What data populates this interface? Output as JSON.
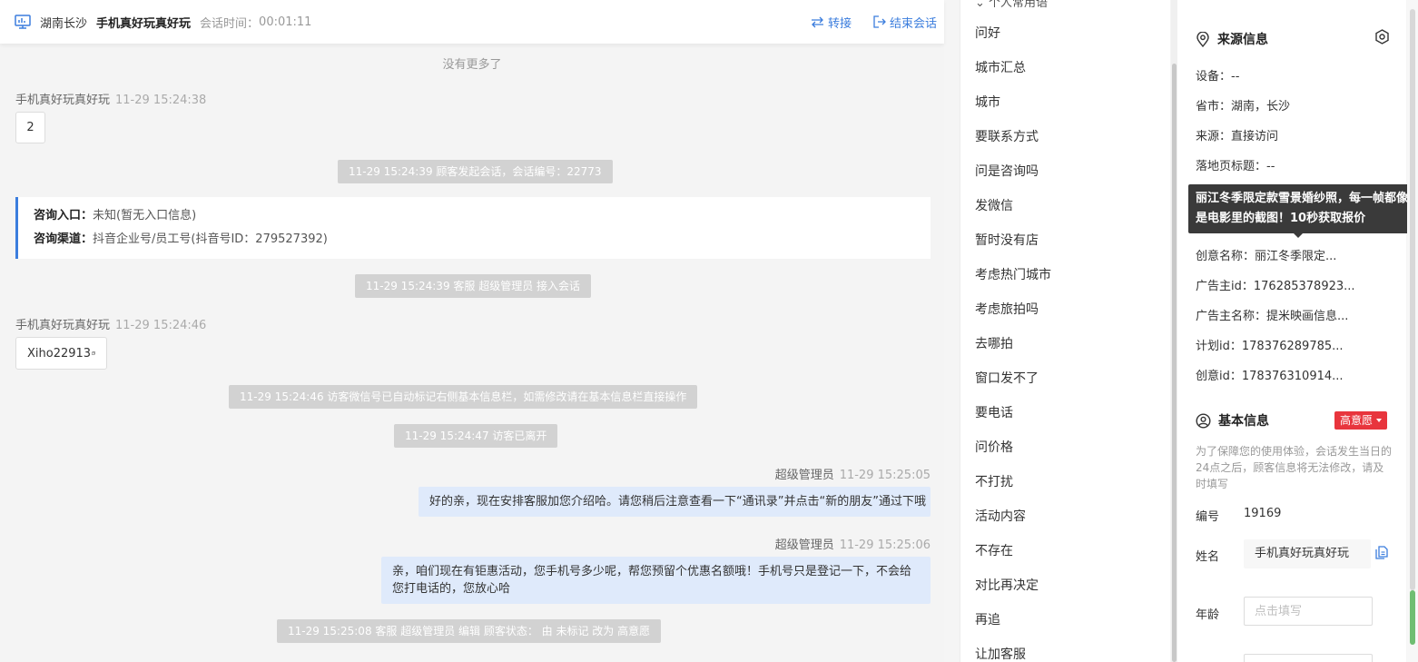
{
  "header": {
    "city": "湖南长沙",
    "visitor_name": "手机真好玩真好玩",
    "session_time_label": "会话时间：",
    "session_time": "00:01:11",
    "transfer_label": "转接",
    "end_session_label": "结束会话"
  },
  "chat": {
    "no_more": "没有更多了",
    "msg1_sender": "手机真好玩真好玩",
    "msg1_time": "11-29 15:24:38",
    "msg1_text": "2",
    "sys1": "11-29 15:24:39 顾客发起会话，会话编号：22773",
    "card_entry_label": "咨询入口：",
    "card_entry_value": "未知(暂无入口信息)",
    "card_channel_label": "咨询渠道：",
    "card_channel_value": "抖音企业号/员工号(抖音号ID：279527392)",
    "sys2": "11-29 15:24:39 客服 超级管理员 接入会话",
    "msg2_sender": "手机真好玩真好玩",
    "msg2_time": "11-29 15:24:46",
    "msg2_text": "Xiho22913",
    "sys3": "11-29 15:24:46 访客微信号已自动标记右侧基本信息栏，如需修改请在基本信息栏直接操作",
    "sys4": "11-29 15:24:47 访客已离开",
    "agent1_sender": "超级管理员",
    "agent1_time": "11-29 15:25:05",
    "agent1_text": "好的亲，现在安排客服加您介绍哈。请您稍后注意查看一下“通讯录”并点击“新的朋友”通过下哦",
    "agent2_sender": "超级管理员",
    "agent2_time": "11-29 15:25:06",
    "agent2_text": "亲，咱们现在有钜惠活动，您手机号多少呢，帮您预留个优惠名额哦！手机号只是登记一下，不会给您打电话的，您放心哈",
    "sys5": "11-29 15:25:08 客服 超级管理员 编辑 顾客状态： 由 未标记 改为 高意愿"
  },
  "quick_replies": {
    "heading": "个人常用语",
    "items": [
      "问好",
      "城市汇总",
      "城市",
      "要联系方式",
      "问是咨询吗",
      "发微信",
      "暂时没有店",
      "考虑热门城市",
      "考虑旅拍吗",
      "去哪拍",
      "窗口发不了",
      "要电话",
      "问价格",
      "不打扰",
      "活动内容",
      "不存在",
      "对比再决定",
      "再追",
      "让加客服"
    ]
  },
  "source_info": {
    "title": "来源信息",
    "device_label": "设备：",
    "device_value": "--",
    "province_label": "省市：",
    "province_value": "湖南，长沙",
    "source_label": "来源：",
    "source_value": "直接访问",
    "landing_title_label": "落地页标题：",
    "landing_title_value": "--",
    "creative_name_label": "创意名称：",
    "creative_name_value": "丽江冬季限定...",
    "advertiser_id_label": "广告主id：",
    "advertiser_id_value": "176285378923...",
    "advertiser_name_label": "广告主名称：",
    "advertiser_name_value": "提米映画信息...",
    "plan_id_label": "计划id：",
    "plan_id_value": "178376289785...",
    "creative_id_label": "创意id：",
    "creative_id_value": "178376310914...",
    "tooltip": "丽江冬季限定款雪景婚纱照，每一帧都像是电影里的截图！10秒获取报价"
  },
  "basic_info": {
    "title": "基本信息",
    "intent_badge": "高意愿",
    "notice": "为了保障您的使用体验，会话发生当日的24点之后，顾客信息将无法修改，请及时填写",
    "id_label": "编号",
    "id_value": "19169",
    "name_label": "姓名",
    "name_value": "手机真好玩真好玩",
    "age_label": "年龄",
    "age_placeholder": "点击填写"
  },
  "colors": {
    "accent": "#3b7ddd",
    "badge_red": "#e8353d",
    "agent_bubble": "#dfeafb",
    "system_msg": "#d2d2d2"
  }
}
